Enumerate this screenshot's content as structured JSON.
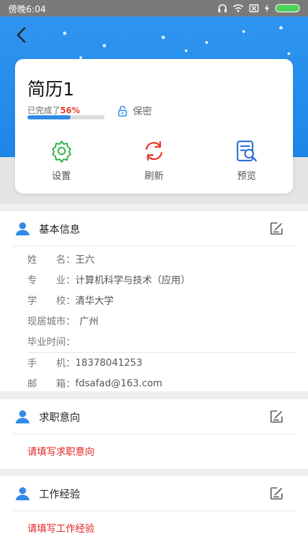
{
  "status_bar": {
    "time": "傍晚6:04"
  },
  "resume": {
    "title": "简历1",
    "progress_prefix": "已完成了",
    "progress_value": "56%",
    "progress_fraction": 0.56,
    "privacy_label": "保密"
  },
  "actions": [
    {
      "label": "设置",
      "icon": "gear-icon",
      "color": "#2cb24a"
    },
    {
      "label": "刷新",
      "icon": "refresh-icon",
      "color": "#e8392a"
    },
    {
      "label": "预览",
      "icon": "preview-icon",
      "color": "#2f6ed8"
    }
  ],
  "basic_info": {
    "title": "基本信息",
    "fields": [
      {
        "key": "姓　　名：",
        "value": "王六"
      },
      {
        "key": "专　　业：",
        "value": "计算机科学与技术（应用）"
      },
      {
        "key": "学　　校：",
        "value": "清华大学"
      },
      {
        "key": "现居城市：",
        "value": "广州"
      },
      {
        "key": "毕业时间：",
        "value": ""
      },
      {
        "key": "手　　机：",
        "value": "18378041253"
      },
      {
        "key": "邮　　箱：",
        "value": "fdsafad@163.com"
      }
    ]
  },
  "job_intention": {
    "title": "求职意向",
    "prompt": "请填写求职意向"
  },
  "work_experience": {
    "title": "工作经验",
    "prompt": "请填写工作经验"
  },
  "colors": {
    "primary": "#2f8ae8",
    "warning": "#e02020",
    "accent_red": "#e8392a"
  }
}
